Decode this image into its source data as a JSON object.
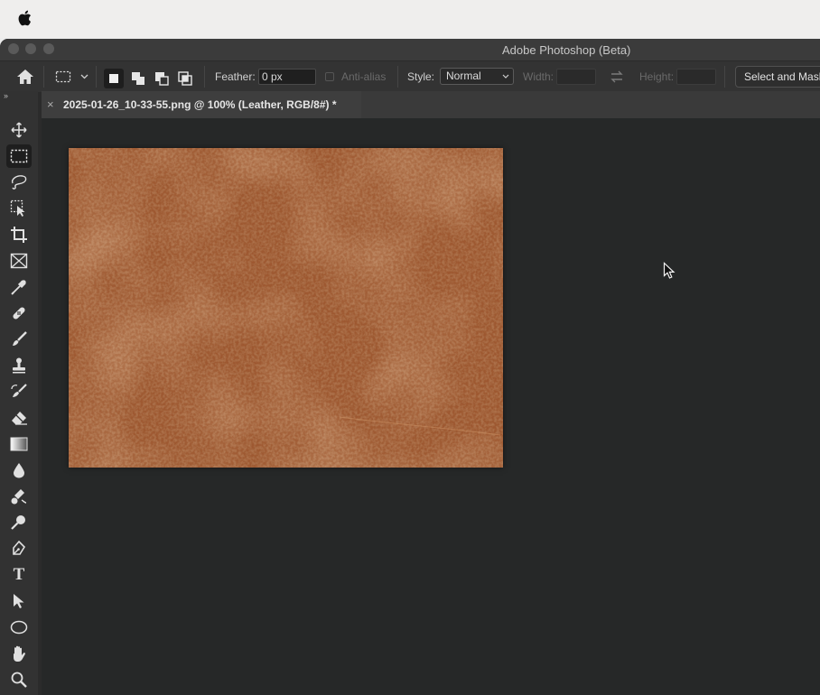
{
  "app": {
    "window_title": "Adobe Photoshop (Beta)"
  },
  "options_bar": {
    "feather_label": "Feather:",
    "feather_value": "0 px",
    "antialias_label": "Anti-alias",
    "style_label": "Style:",
    "style_value": "Normal",
    "width_label": "Width:",
    "height_label": "Height:",
    "select_and_mask_label": "Select and Mask"
  },
  "document_tab": {
    "title": "2025-01-26_10-33-55.png @ 100% (Leather, RGB/8#) *",
    "close_glyph": "×"
  },
  "toolbar": {
    "expand_glyph": "››",
    "tools": [
      {
        "name": "move-tool",
        "icon": "move-icon"
      },
      {
        "name": "rectangular-marquee-tool",
        "icon": "marquee-icon",
        "active": true
      },
      {
        "name": "lasso-tool",
        "icon": "lasso-icon"
      },
      {
        "name": "object-selection-tool",
        "icon": "object-selection-icon"
      },
      {
        "name": "crop-tool",
        "icon": "crop-icon"
      },
      {
        "name": "frame-tool",
        "icon": "frame-icon"
      },
      {
        "name": "eyedropper-tool",
        "icon": "eyedropper-icon"
      },
      {
        "name": "healing-brush-tool",
        "icon": "bandage-icon"
      },
      {
        "name": "brush-tool",
        "icon": "brush-icon"
      },
      {
        "name": "clone-stamp-tool",
        "icon": "stamp-icon"
      },
      {
        "name": "history-brush-tool",
        "icon": "history-brush-icon"
      },
      {
        "name": "eraser-tool",
        "icon": "eraser-icon"
      },
      {
        "name": "gradient-tool",
        "icon": "gradient-icon"
      },
      {
        "name": "blur-tool",
        "icon": "drop-icon"
      },
      {
        "name": "dodge-tool",
        "icon": "dodge-icon"
      },
      {
        "name": "smudge-tool",
        "icon": "smudge-icon"
      },
      {
        "name": "pen-tool",
        "icon": "pen-icon"
      },
      {
        "name": "type-tool",
        "icon": "type-icon",
        "glyph": "T"
      },
      {
        "name": "path-selection-tool",
        "icon": "arrow-icon"
      },
      {
        "name": "ellipse-tool",
        "icon": "ellipse-icon"
      },
      {
        "name": "hand-tool",
        "icon": "hand-icon"
      },
      {
        "name": "zoom-tool",
        "icon": "zoom-icon"
      }
    ]
  },
  "colors": {
    "canvas_bg": "#262828",
    "leather_base": "#a05a32",
    "leather_light": "#c07a4a",
    "leather_dark": "#7e4223"
  }
}
